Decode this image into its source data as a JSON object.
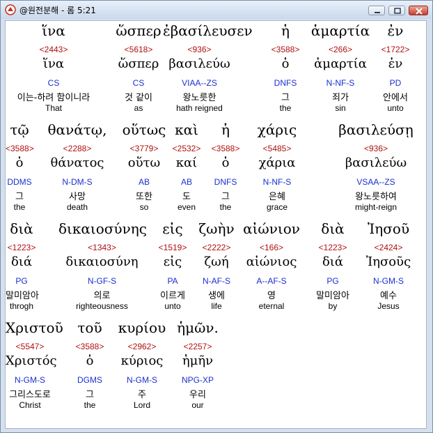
{
  "window": {
    "title": "@원전분해 - 롬 5:21",
    "controls": [
      "minimize-icon",
      "maximize-icon",
      "close-icon"
    ]
  },
  "rows": [
    {
      "words": [
        {
          "surface": "ἵνα",
          "strong": "<2443>",
          "lemma": "ἵνα",
          "parse": "CS",
          "korean": "이는-하려 함이니라",
          "english": "That",
          "selected": true
        },
        {
          "surface": "ὥσπερ",
          "strong": "<5618>",
          "lemma": "ὥσπερ",
          "parse": "CS",
          "korean": "것 같이",
          "english": "as"
        },
        {
          "surface": "ἐβασίλευσεν",
          "strong": "<936>",
          "lemma": "βασιλεύω",
          "parse": "VIAA--ZS",
          "korean": "왕노릇한",
          "english": "hath reigned"
        },
        {
          "surface": "ἡ",
          "strong": "<3588>",
          "lemma": "ὁ",
          "parse": "DNFS",
          "korean": "그",
          "english": "the"
        },
        {
          "surface": "ἁμαρτία",
          "strong": "<266>",
          "lemma": "ἁμαρτία",
          "parse": "N-NF-S",
          "korean": "죄가",
          "english": "sin"
        },
        {
          "surface": "ἐν",
          "strong": "<1722>",
          "lemma": "ἐν",
          "parse": "PD",
          "korean": "안에서",
          "english": "unto"
        }
      ]
    },
    {
      "words": [
        {
          "surface": "τῷ",
          "strong": "<3588>",
          "lemma": "ὁ",
          "parse": "DDMS",
          "korean": "그",
          "english": "the"
        },
        {
          "surface": "θανάτῳ,",
          "strong": "<2288>",
          "lemma": "θάνατος",
          "parse": "N-DM-S",
          "korean": "사망",
          "english": "death"
        },
        {
          "surface": "οὕτως",
          "strong": "<3779>",
          "lemma": "οὕτω",
          "parse": "AB",
          "korean": "또한",
          "english": "so"
        },
        {
          "surface": "καὶ",
          "strong": "<2532>",
          "lemma": "καί",
          "parse": "AB",
          "korean": "도",
          "english": "even"
        },
        {
          "surface": "ἡ",
          "strong": "<3588>",
          "lemma": "ὁ",
          "parse": "DNFS",
          "korean": "그",
          "english": "the"
        },
        {
          "surface": "χάρις",
          "strong": "<5485>",
          "lemma": "χάρια",
          "parse": "N-NF-S",
          "korean": "은혜",
          "english": "grace"
        },
        {
          "surface": "βασιλεύσῃ",
          "strong": "<936>",
          "lemma": "βασιλεύω",
          "parse": "VSAA--ZS",
          "korean": "왕노릇하여",
          "english": "might-reign"
        }
      ]
    },
    {
      "words": [
        {
          "surface": "διὰ",
          "strong": "<1223>",
          "lemma": "διά",
          "parse": "PG",
          "korean": "말미암아",
          "english": "throgh"
        },
        {
          "surface": "δικαιοσύνης",
          "strong": "<1343>",
          "lemma": "δικαιοσύνη",
          "parse": "N-GF-S",
          "korean": "의로",
          "english": "righteousness"
        },
        {
          "surface": "εἰς",
          "strong": "<1519>",
          "lemma": "εἰς",
          "parse": "PA",
          "korean": "이르게",
          "english": "unto"
        },
        {
          "surface": "ζωὴν",
          "strong": "<2222>",
          "lemma": "ζωή",
          "parse": "N-AF-S",
          "korean": "생에",
          "english": "life"
        },
        {
          "surface": "αἰώνιον",
          "strong": "<166>",
          "lemma": "αἰώνιος",
          "parse": "A--AF-S",
          "korean": "영",
          "english": "eternal"
        },
        {
          "surface": "διὰ",
          "strong": "<1223>",
          "lemma": "διά",
          "parse": "PG",
          "korean": "말미암아",
          "english": "by"
        },
        {
          "surface": "Ἰησοῦ",
          "strong": "<2424>",
          "lemma": "Ἰησοῦς",
          "parse": "N-GM-S",
          "korean": "예수",
          "english": "Jesus"
        }
      ]
    },
    {
      "words": [
        {
          "surface": "Χριστοῦ",
          "strong": "<5547>",
          "lemma": "Χριστός",
          "parse": "N-GM-S",
          "korean": "그리스도로",
          "english": "Christ"
        },
        {
          "surface": "τοῦ",
          "strong": "<3588>",
          "lemma": "ὁ",
          "parse": "DGMS",
          "korean": "그",
          "english": "the"
        },
        {
          "surface": "κυρίου",
          "strong": "<2962>",
          "lemma": "κύριος",
          "parse": "N-GM-S",
          "korean": "주",
          "english": "Lord"
        },
        {
          "surface": "ἡμῶν.",
          "strong": "<2257>",
          "lemma": "ἡμῆν",
          "parse": "NPG-XP",
          "korean": "우리",
          "english": "our"
        }
      ]
    }
  ],
  "colors": {
    "strong": "#b01010",
    "parse": "#1a2fd0",
    "text": "#000000",
    "client_background": "#ffffff"
  }
}
